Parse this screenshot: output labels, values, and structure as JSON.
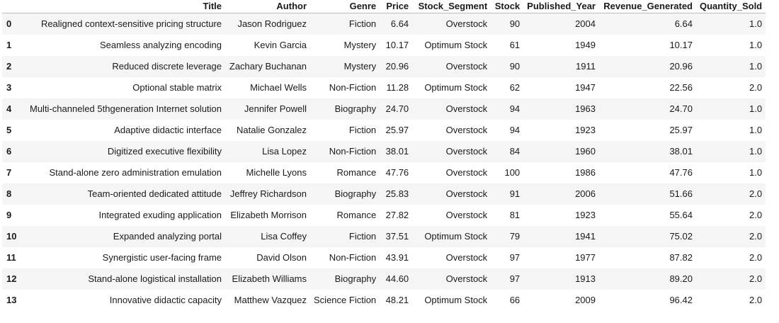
{
  "table": {
    "columns": [
      "",
      "Title",
      "Author",
      "Genre",
      "Price",
      "Stock_Segment",
      "Stock",
      "Published_Year",
      "Revenue_Generated",
      "Quantity_Sold"
    ],
    "rows": [
      [
        "0",
        "Realigned context-sensitive pricing structure",
        "Jason Rodriguez",
        "Fiction",
        "6.64",
        "Overstock",
        "90",
        "2004",
        "6.64",
        "1.0"
      ],
      [
        "1",
        "Seamless analyzing encoding",
        "Kevin Garcia",
        "Mystery",
        "10.17",
        "Optimum Stock",
        "61",
        "1949",
        "10.17",
        "1.0"
      ],
      [
        "2",
        "Reduced discrete leverage",
        "Zachary Buchanan",
        "Mystery",
        "20.96",
        "Overstock",
        "90",
        "1911",
        "20.96",
        "1.0"
      ],
      [
        "3",
        "Optional stable matrix",
        "Michael Wells",
        "Non-Fiction",
        "11.28",
        "Optimum Stock",
        "62",
        "1947",
        "22.56",
        "2.0"
      ],
      [
        "4",
        "Multi-channeled 5thgeneration Internet solution",
        "Jennifer Powell",
        "Biography",
        "24.70",
        "Overstock",
        "94",
        "1963",
        "24.70",
        "1.0"
      ],
      [
        "5",
        "Adaptive didactic interface",
        "Natalie Gonzalez",
        "Fiction",
        "25.97",
        "Overstock",
        "94",
        "1923",
        "25.97",
        "1.0"
      ],
      [
        "6",
        "Digitized executive flexibility",
        "Lisa Lopez",
        "Non-Fiction",
        "38.01",
        "Overstock",
        "84",
        "1960",
        "38.01",
        "1.0"
      ],
      [
        "7",
        "Stand-alone zero administration emulation",
        "Michelle Lyons",
        "Romance",
        "47.76",
        "Overstock",
        "100",
        "1986",
        "47.76",
        "1.0"
      ],
      [
        "8",
        "Team-oriented dedicated attitude",
        "Jeffrey Richardson",
        "Biography",
        "25.83",
        "Overstock",
        "91",
        "2006",
        "51.66",
        "2.0"
      ],
      [
        "9",
        "Integrated exuding application",
        "Elizabeth Morrison",
        "Romance",
        "27.82",
        "Overstock",
        "81",
        "1923",
        "55.64",
        "2.0"
      ],
      [
        "10",
        "Expanded analyzing portal",
        "Lisa Coffey",
        "Fiction",
        "37.51",
        "Optimum Stock",
        "79",
        "1941",
        "75.02",
        "2.0"
      ],
      [
        "11",
        "Synergistic user-facing frame",
        "David Olson",
        "Non-Fiction",
        "43.91",
        "Overstock",
        "97",
        "1977",
        "87.82",
        "2.0"
      ],
      [
        "12",
        "Stand-alone logistical installation",
        "Elizabeth Williams",
        "Biography",
        "44.60",
        "Overstock",
        "97",
        "1913",
        "89.20",
        "2.0"
      ],
      [
        "13",
        "Innovative didactic capacity",
        "Matthew Vazquez",
        "Science Fiction",
        "48.21",
        "Optimum Stock",
        "66",
        "2009",
        "96.42",
        "2.0"
      ]
    ]
  },
  "colors": {
    "stripe": "#f5f5f5",
    "background": "#ffffff",
    "header_border": "#bdbdbd",
    "text": "#1a1a1a"
  }
}
